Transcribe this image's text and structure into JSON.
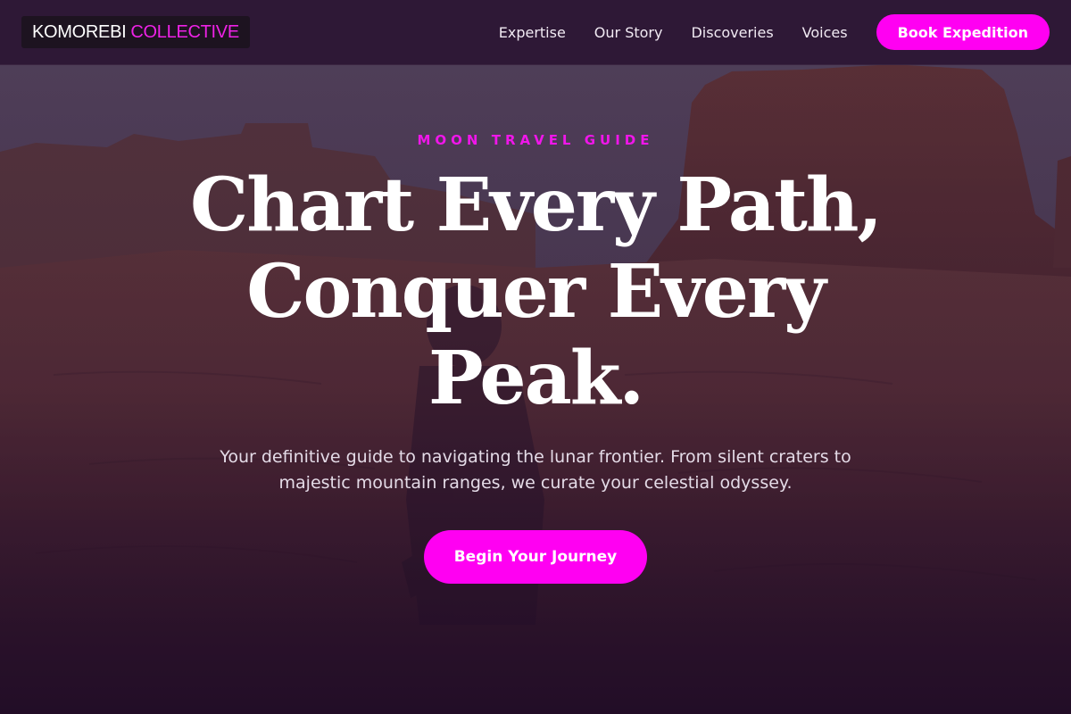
{
  "header": {
    "logo": {
      "primary": "KOMOREBI",
      "accent": "COLLECTIVE"
    },
    "nav": [
      {
        "label": "Expertise"
      },
      {
        "label": "Our Story"
      },
      {
        "label": "Discoveries"
      },
      {
        "label": "Voices"
      }
    ],
    "cta_label": "Book Expedition"
  },
  "hero": {
    "eyebrow": "MOON TRAVEL GUIDE",
    "headline": {
      "line1": "Chart Every Path,",
      "line2": "Conquer Every",
      "line3": "Peak."
    },
    "subtext": "Your definitive guide to navigating the lunar frontier. From silent craters to majestic mountain ranges, we curate your celestial odyssey.",
    "cta_label": "Begin Your Journey"
  },
  "colors": {
    "accent": "#ff00f2",
    "header_bg": "#2c1634",
    "overlay": "#1a0b22"
  }
}
